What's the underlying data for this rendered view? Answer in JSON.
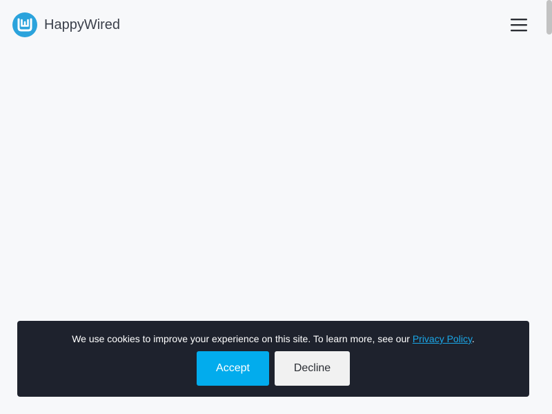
{
  "header": {
    "brand_name": "HappyWired",
    "logo_icon": "happywired-logo-icon",
    "menu_icon": "hamburger-menu-icon"
  },
  "cookie_banner": {
    "message": "We use cookies to improve your experience on this site. To learn more, see our ",
    "link_text": "Privacy Policy",
    "suffix": ".",
    "accept_label": "Accept",
    "decline_label": "Decline"
  },
  "colors": {
    "page_background": "#f7f8fa",
    "brand_blue": "#2ba3dc",
    "banner_background": "#1e222d",
    "accept_button": "#02aced",
    "decline_button": "#f1f1f1",
    "link": "#1aa7e8"
  }
}
